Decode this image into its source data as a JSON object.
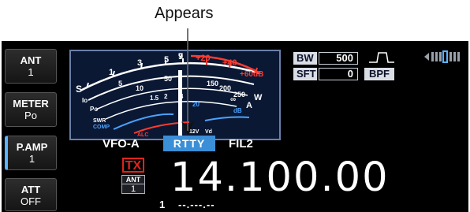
{
  "callout": {
    "text": "Appears"
  },
  "sidebar": {
    "buttons": [
      {
        "title": "ANT",
        "value": "1"
      },
      {
        "title": "METER",
        "value": "Po"
      },
      {
        "title": "P.AMP",
        "value": "1"
      },
      {
        "title": "ATT",
        "value": "OFF"
      }
    ]
  },
  "meter": {
    "s_scale": {
      "prefix": "S",
      "ticks": [
        "1",
        "3",
        "5",
        "7",
        "9"
      ],
      "over_ticks": [
        "+20",
        "+40",
        "+60dB"
      ]
    },
    "po_scale": {
      "ticks": [
        "0",
        "5",
        "10",
        "50",
        "150",
        "200",
        "250"
      ],
      "unit": "W"
    },
    "swr_scale": {
      "ticks": [
        "1",
        "1.5",
        "2",
        "3",
        "∞"
      ]
    },
    "extra_scale": {
      "ticks": [
        "5",
        "10",
        "15",
        "20",
        "25"
      ],
      "unit": "A"
    },
    "row_labels": {
      "id": "Io",
      "po": "Po",
      "swr": "SWR",
      "comp": "COMP",
      "alc": "ALC",
      "vd": "Vd",
      "volt": "12V",
      "db": "dB"
    },
    "colors": {
      "scale": "#ffffff",
      "over": "#ff3b30",
      "comp": "#4aa3ff",
      "needle": "#ffffff"
    }
  },
  "filter": {
    "bw_label": "BW",
    "bw_value": "500",
    "sft_label": "SFT",
    "sft_value": "0",
    "bpf_label": "BPF",
    "shape_icon": "filter-shape-icon",
    "tuning_icon": "tuning-indicator-icon"
  },
  "vfo": {
    "label": "VFO-A",
    "mode": "RTTY",
    "filter": "FIL2"
  },
  "tx": {
    "label": "TX"
  },
  "ant_indicator": {
    "label": "ANT",
    "value": "1"
  },
  "frequency": "14.100.00",
  "sub_freq": {
    "label": "1",
    "value": "--.---.--"
  },
  "colors": {
    "accent": "#3b8fd6",
    "tx": "#e0241b",
    "background": "#000000",
    "button_active_edge": "#5ab4ff"
  }
}
